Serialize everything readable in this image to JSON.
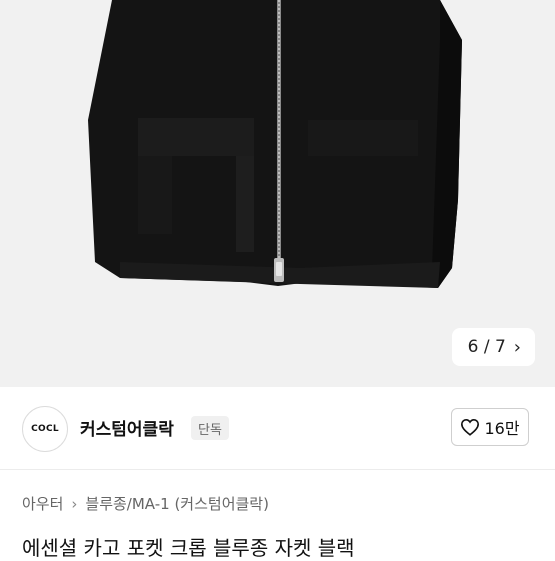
{
  "gallery": {
    "page_indicator": "6 / 7",
    "next_icon": "chevron-right-icon"
  },
  "seller": {
    "logo_text": "COCL",
    "name": "커스텀어클락",
    "badge": "단독"
  },
  "like": {
    "count": "16만",
    "icon": "heart-outline-icon"
  },
  "breadcrumb": {
    "items": [
      "아우터",
      "블루종/MA-1 (커스텀어클락)"
    ],
    "separator_icon": "chevron-right-icon"
  },
  "product": {
    "title": "에센셜 카고 포켓 크롭 블루종 자켓 블랙"
  }
}
